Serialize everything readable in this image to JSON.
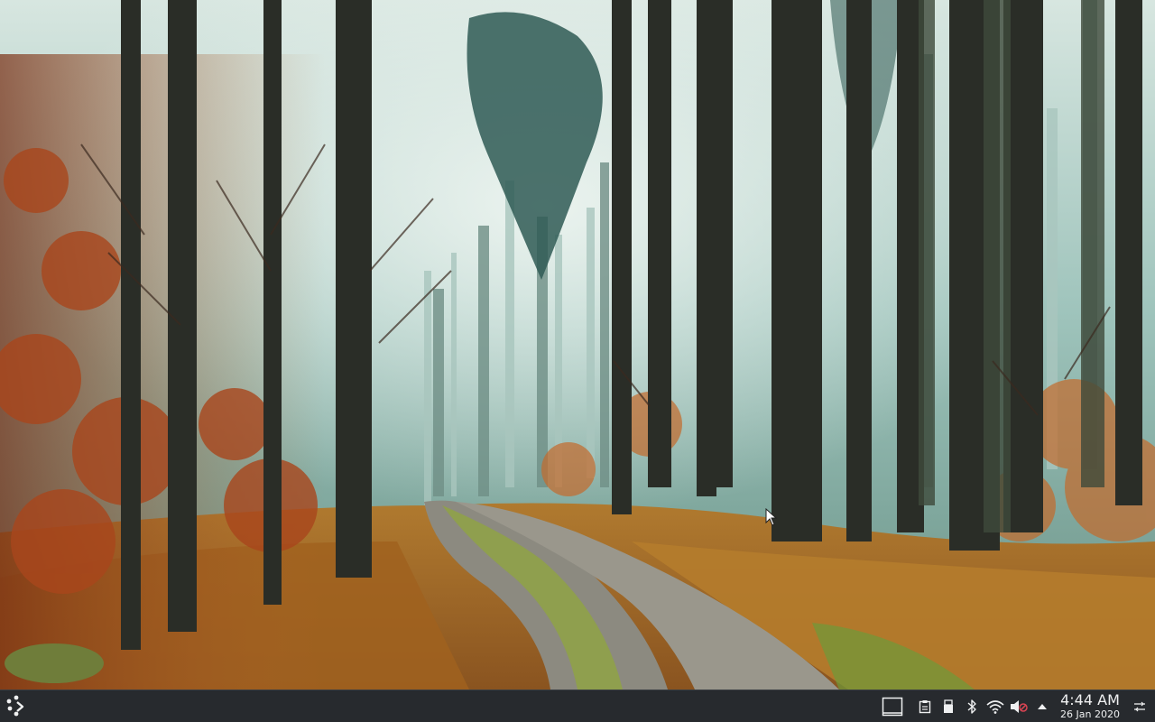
{
  "desktop": {
    "wallpaper": "misty-autumn-forest-path",
    "colors": {
      "fog": "#8fb3ac",
      "trunk": "#2a2d27",
      "foliage": "#b5652a",
      "grass": "#c98f3a",
      "path": "#8c8a80"
    }
  },
  "taskbar": {
    "background": "#272a2e",
    "launcher_icon": "application-launcher-icon",
    "tray_icons": [
      "show-desktop-icon",
      "clipboard-icon",
      "removable-device-icon",
      "bluetooth-icon",
      "wifi-icon",
      "volume-muted-icon",
      "expand-tray-arrow-icon"
    ],
    "clock": {
      "time": "4:44 AM",
      "date": "26 Jan 2020"
    },
    "settings_icon": "panel-options-icon"
  }
}
